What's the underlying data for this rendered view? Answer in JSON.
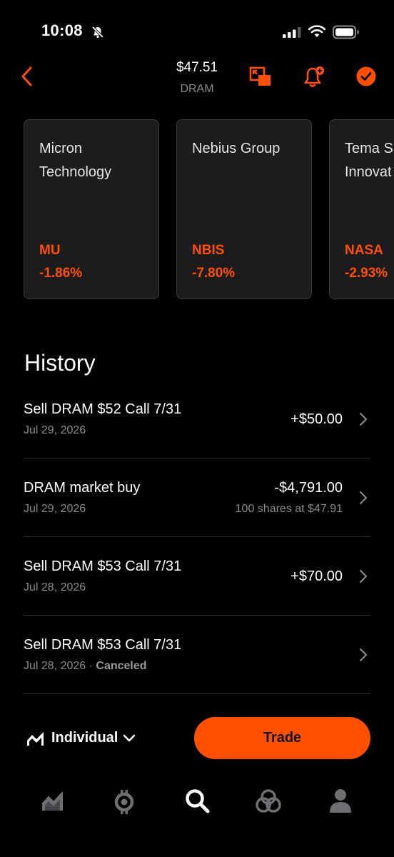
{
  "status_bar": {
    "time": "10:08"
  },
  "header": {
    "price": "$47.51",
    "symbol": "DRAM"
  },
  "cards": [
    {
      "name": "Micron Technology",
      "ticker": "MU",
      "change": "-1.86%"
    },
    {
      "name": "Nebius Group",
      "ticker": "NBIS",
      "change": "-7.80%"
    },
    {
      "name": "Tema S Innovat",
      "ticker": "NASA",
      "change": "-2.93%"
    }
  ],
  "history": {
    "title": "History",
    "rows": [
      {
        "title": "Sell DRAM $52 Call 7/31",
        "date": "Jul 29, 2026",
        "amount": "+$50.00",
        "sub": ""
      },
      {
        "title": "DRAM market buy",
        "date": "Jul 29, 2026",
        "amount": "-$4,791.00",
        "sub": "100 shares at $47.91"
      },
      {
        "title": "Sell DRAM $53 Call 7/31",
        "date": "Jul 28, 2026",
        "amount": "+$70.00",
        "sub": ""
      },
      {
        "title": "Sell DRAM $53 Call 7/31",
        "date": "Jul 28, 2026",
        "separator": " · ",
        "status": "Canceled",
        "amount": "",
        "sub": ""
      }
    ]
  },
  "account": {
    "label": "Individual"
  },
  "trade_button": {
    "label": "Trade"
  },
  "colors": {
    "accent": "#ff5000",
    "background": "#000000",
    "card": "#1c1c1e",
    "muted": "#8a8a8e"
  },
  "nav": {
    "icons": [
      "chart-icon",
      "crypto-icon",
      "search-icon",
      "networks-icon",
      "profile-icon"
    ],
    "active": "search-icon"
  }
}
